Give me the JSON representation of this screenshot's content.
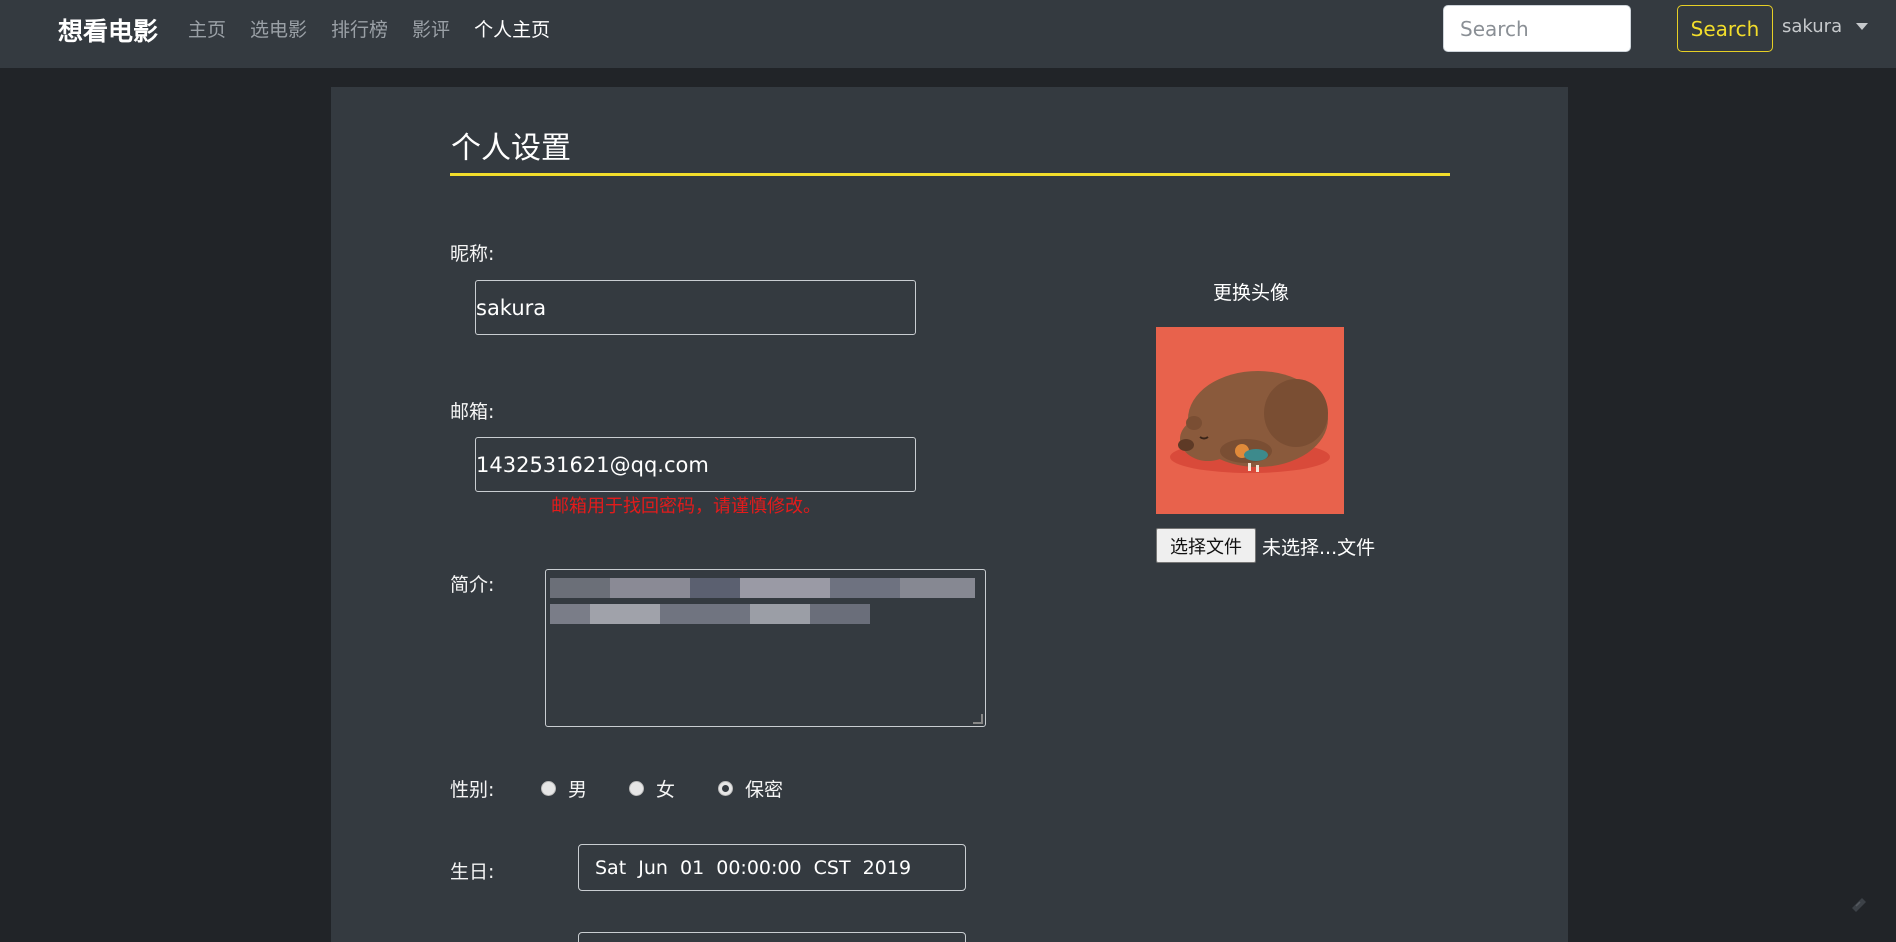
{
  "navbar": {
    "brand": "想看电影",
    "links": [
      "主页",
      "选电影",
      "排行榜",
      "影评",
      "个人主页"
    ],
    "search_placeholder": "Search",
    "search_button": "Search",
    "user": "sakura"
  },
  "settings": {
    "title": "个人设置",
    "nickname_label": "昵称:",
    "nickname_value": "sakura",
    "email_label": "邮箱:",
    "email_value": "1432531621@qq.com",
    "email_hint": "邮箱用于找回密码，请谨慎修改。",
    "bio_label": "简介:",
    "gender_label": "性别:",
    "gender_options": [
      "男",
      "女",
      "保密"
    ],
    "gender_selected": "保密",
    "birthday_label": "生日:",
    "birthday_value": "Sat  Jun  01  00:00:00  CST  2019"
  },
  "avatar": {
    "title": "更换头像",
    "file_button": "选择文件",
    "file_status": "未选择...文件"
  },
  "colors": {
    "accent": "#f2dd2b",
    "navbar_bg": "#343a40",
    "page_bg": "#212428",
    "hint": "#e31b1b",
    "avatar_bg": "#e8624c"
  }
}
